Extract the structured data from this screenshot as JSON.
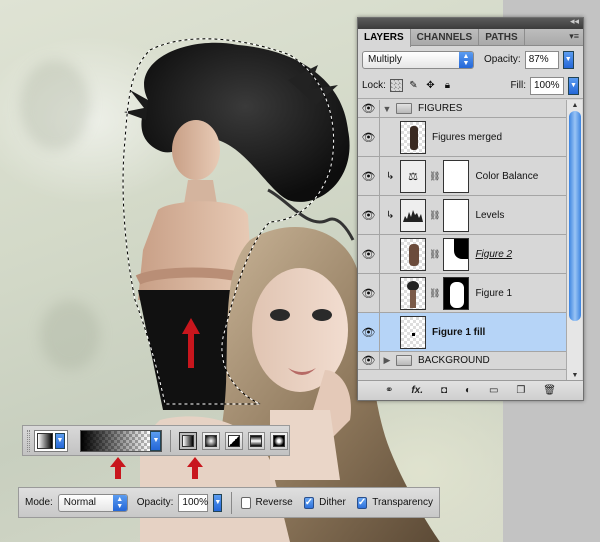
{
  "panel": {
    "tabs": [
      "LAYERS",
      "CHANNELS",
      "PATHS"
    ],
    "blend_mode": "Multiply",
    "opacity_label": "Opacity:",
    "opacity_value": "87%",
    "lock_label": "Lock:",
    "fill_label": "Fill:",
    "fill_value": "100%",
    "layers": [
      {
        "name": "FIGURES",
        "kind": "group"
      },
      {
        "name": "Figures merged",
        "kind": "pixel"
      },
      {
        "name": "Color Balance",
        "kind": "adjustment",
        "icon": "scale-icon"
      },
      {
        "name": "Levels",
        "kind": "adjustment",
        "icon": "histogram-icon"
      },
      {
        "name": "Figure 2",
        "kind": "pixel-mask"
      },
      {
        "name": "Figure 1",
        "kind": "pixel-mask"
      },
      {
        "name": "Figure 1 fill",
        "kind": "pixel",
        "selected": true
      },
      {
        "name": "BACKGROUND",
        "kind": "group"
      }
    ]
  },
  "gradient_options": {
    "mode_label": "Mode:",
    "mode_value": "Normal",
    "opacity_label": "Opacity:",
    "opacity_value": "100%",
    "reverse_label": "Reverse",
    "reverse_checked": false,
    "dither_label": "Dither",
    "dither_checked": true,
    "transparency_label": "Transparency",
    "transparency_checked": true
  },
  "colors": {
    "selected_layer": "#b6d4f7",
    "accent_blue": "#2467d8",
    "arrow_red": "#c8161d"
  }
}
